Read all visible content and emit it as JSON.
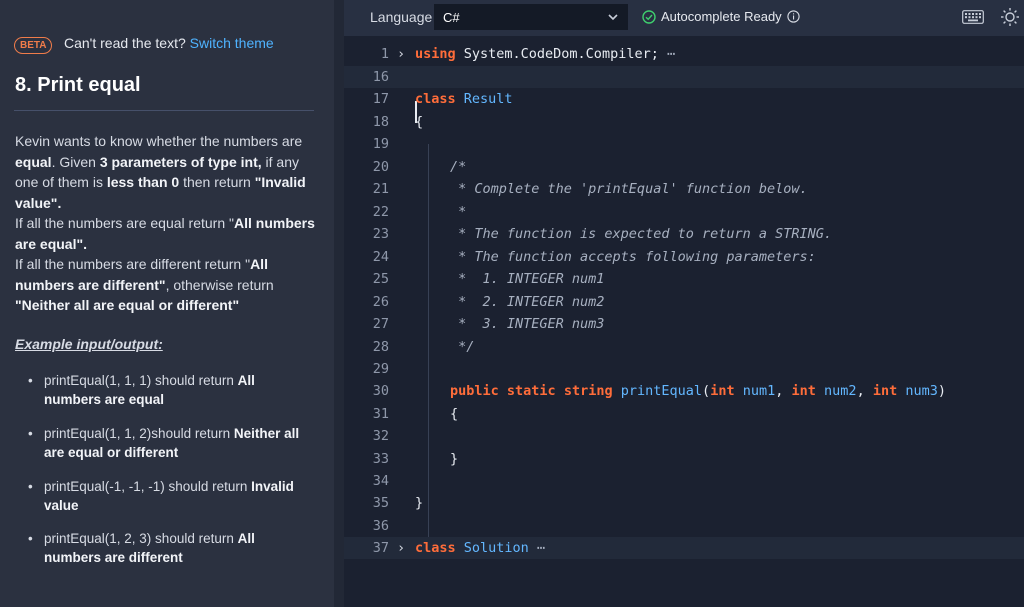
{
  "banner": {
    "badge": "BETA",
    "text": "Can't read the text?",
    "link": "Switch theme"
  },
  "problem": {
    "title": "8. Print equal",
    "desc": {
      "s1": "Kevin wants to know whether the numbers are ",
      "b1": "equal",
      "s2": ". Given ",
      "b2": "3 parameters of type int,",
      "s3": " if any one of them is ",
      "b3": "less than 0",
      "s4": " then return ",
      "b4": "\"Invalid value\".",
      "s5": "If all the numbers are equal return \"",
      "b5": "All numbers are equal\".",
      "s6": "If all the numbers are different return \"",
      "b6": "All numbers are different\"",
      "s7": ", otherwise return",
      "b7": "\"Neither all are equal or different\""
    },
    "example_heading": "Example input/output:",
    "examples": [
      {
        "text": "printEqual(1, 1, 1) should return ",
        "bold": "All numbers are equal"
      },
      {
        "text": "printEqual(1, 1, 2)should return ",
        "bold": "Neither all are equal or different"
      },
      {
        "text": "printEqual(-1, -1, -1) should return ",
        "bold": "Invalid value"
      },
      {
        "text": "printEqual(1, 2, 3) should return ",
        "bold": "All numbers are different"
      }
    ]
  },
  "editor": {
    "language_label": "Language",
    "language_value": "C#",
    "autocomplete": "Autocomplete Ready",
    "lines": {
      "l1": "1",
      "l16": "16",
      "l17": "17",
      "l18": "18",
      "l19": "19",
      "l20": "20",
      "l21": "21",
      "l22": "22",
      "l23": "23",
      "l24": "24",
      "l25": "25",
      "l26": "26",
      "l27": "27",
      "l28": "28",
      "l29": "29",
      "l30": "30",
      "l31": "31",
      "l32": "32",
      "l33": "33",
      "l34": "34",
      "l35": "35",
      "l36": "36",
      "l37": "37"
    },
    "code": {
      "using_kw": "using",
      "using_ns": " System.CodeDom.Compiler;",
      "ellipsis": " ⋯",
      "class_kw": "class",
      "class_result": " Result",
      "brace_open": "{",
      "brace_close": "}",
      "c20": "/*",
      "c21": " * Complete the 'printEqual' function below.",
      "c22": " *",
      "c23": " * The function is expected to return a STRING.",
      "c24": " * The function accepts following parameters:",
      "c25": " *  1. INTEGER num1",
      "c26": " *  2. INTEGER num2",
      "c27": " *  3. INTEGER num3",
      "c28": " */",
      "m_public": "public",
      "m_static": "static",
      "m_string": "string",
      "m_name": "printEqual",
      "m_paren_open": "(",
      "m_int": "int",
      "m_num1": "num1",
      "m_num2": "num2",
      "m_num3": "num3",
      "m_comma": ",",
      "m_paren_close": ")",
      "class_solution": " Solution"
    }
  }
}
